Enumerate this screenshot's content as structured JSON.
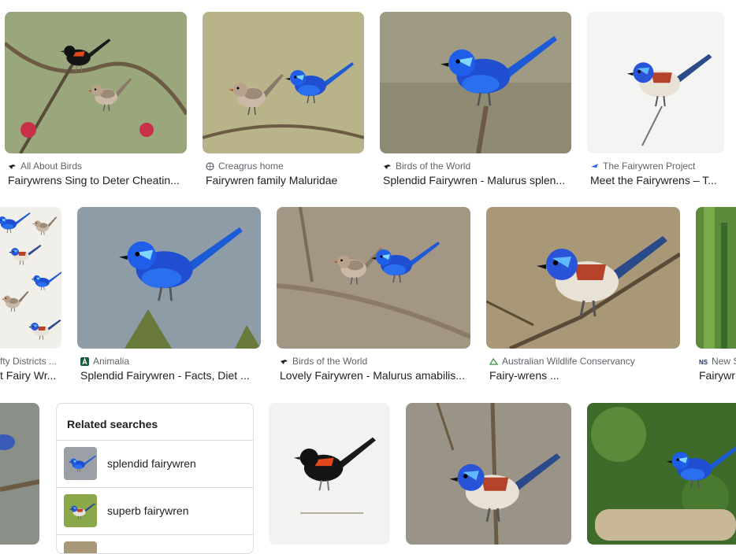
{
  "results": [
    {
      "source": "All About Birds",
      "title": "Fairywrens Sing to Deter Cheatin..."
    },
    {
      "source": "Creagrus home",
      "title": "Fairywren family Maluridae"
    },
    {
      "source": "Birds of the World",
      "title": "Splendid Fairywren - Malurus splen..."
    },
    {
      "source": "The Fairywren Project",
      "title": "Meet the Fairywrens – T..."
    },
    {
      "source": "fty Districts ...",
      "title": "t Fairy Wr..."
    },
    {
      "source": "Animalia",
      "title": "Splendid Fairywren - Facts, Diet ..."
    },
    {
      "source": "Birds of the World",
      "title": "Lovely Fairywren - Malurus amabilis..."
    },
    {
      "source": "Australian Wildlife Conservancy",
      "title": "Fairy-wrens ..."
    },
    {
      "source": "New S",
      "title": "Fairywr"
    }
  ],
  "related": {
    "title": "Related searches",
    "items": [
      {
        "label": "splendid fairywren"
      },
      {
        "label": "superb fairywren"
      }
    ]
  },
  "colors": {
    "accent_blue": "#1f5ff0",
    "text_primary": "#202124",
    "text_secondary": "#5f6368",
    "border": "#dadce0"
  }
}
